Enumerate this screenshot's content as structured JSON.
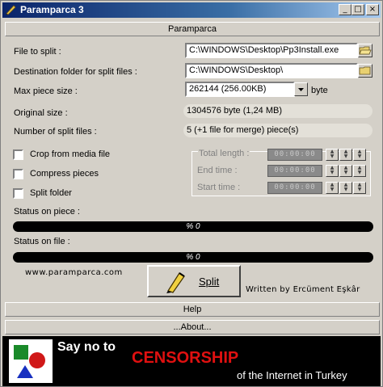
{
  "window": {
    "title": "Paramparca 3"
  },
  "header": {
    "label": "Paramparca"
  },
  "fields": {
    "file_to_split": {
      "label": "File to split :",
      "value": "C:\\WINDOWS\\Desktop\\Pp3Install.exe"
    },
    "destination": {
      "label": "Destination folder for split files :",
      "value": "C:\\WINDOWS\\Desktop\\"
    },
    "max_piece": {
      "label": "Max piece size :",
      "value": "262144 (256.00KB)",
      "unit": "byte"
    },
    "original_size": {
      "label": "Original size :",
      "value": "1304576 byte (1,24 MB)"
    },
    "num_split": {
      "label": "Number of split files :",
      "value": "5 (+1 file for merge) piece(s)"
    }
  },
  "options": {
    "crop": "Crop from media file",
    "compress": "Compress pieces",
    "split_folder": "Split folder"
  },
  "media": {
    "total_length": "Total length :",
    "end_time": "End time :",
    "start_time": "Start time :",
    "digits": "00:00:00"
  },
  "status": {
    "piece_label": "Status on piece :",
    "piece_value": "% 0",
    "file_label": "Status on file :",
    "file_value": "% 0"
  },
  "footer": {
    "website": "www.paramparca.com",
    "split_label": "Split",
    "author": "Written by Ercüment Eşkâr",
    "help": "Help",
    "about": "...About..."
  },
  "banner": {
    "line1": "Say no to",
    "line2": "CENSORSHIP",
    "line3": "of the Internet in Turkey"
  }
}
